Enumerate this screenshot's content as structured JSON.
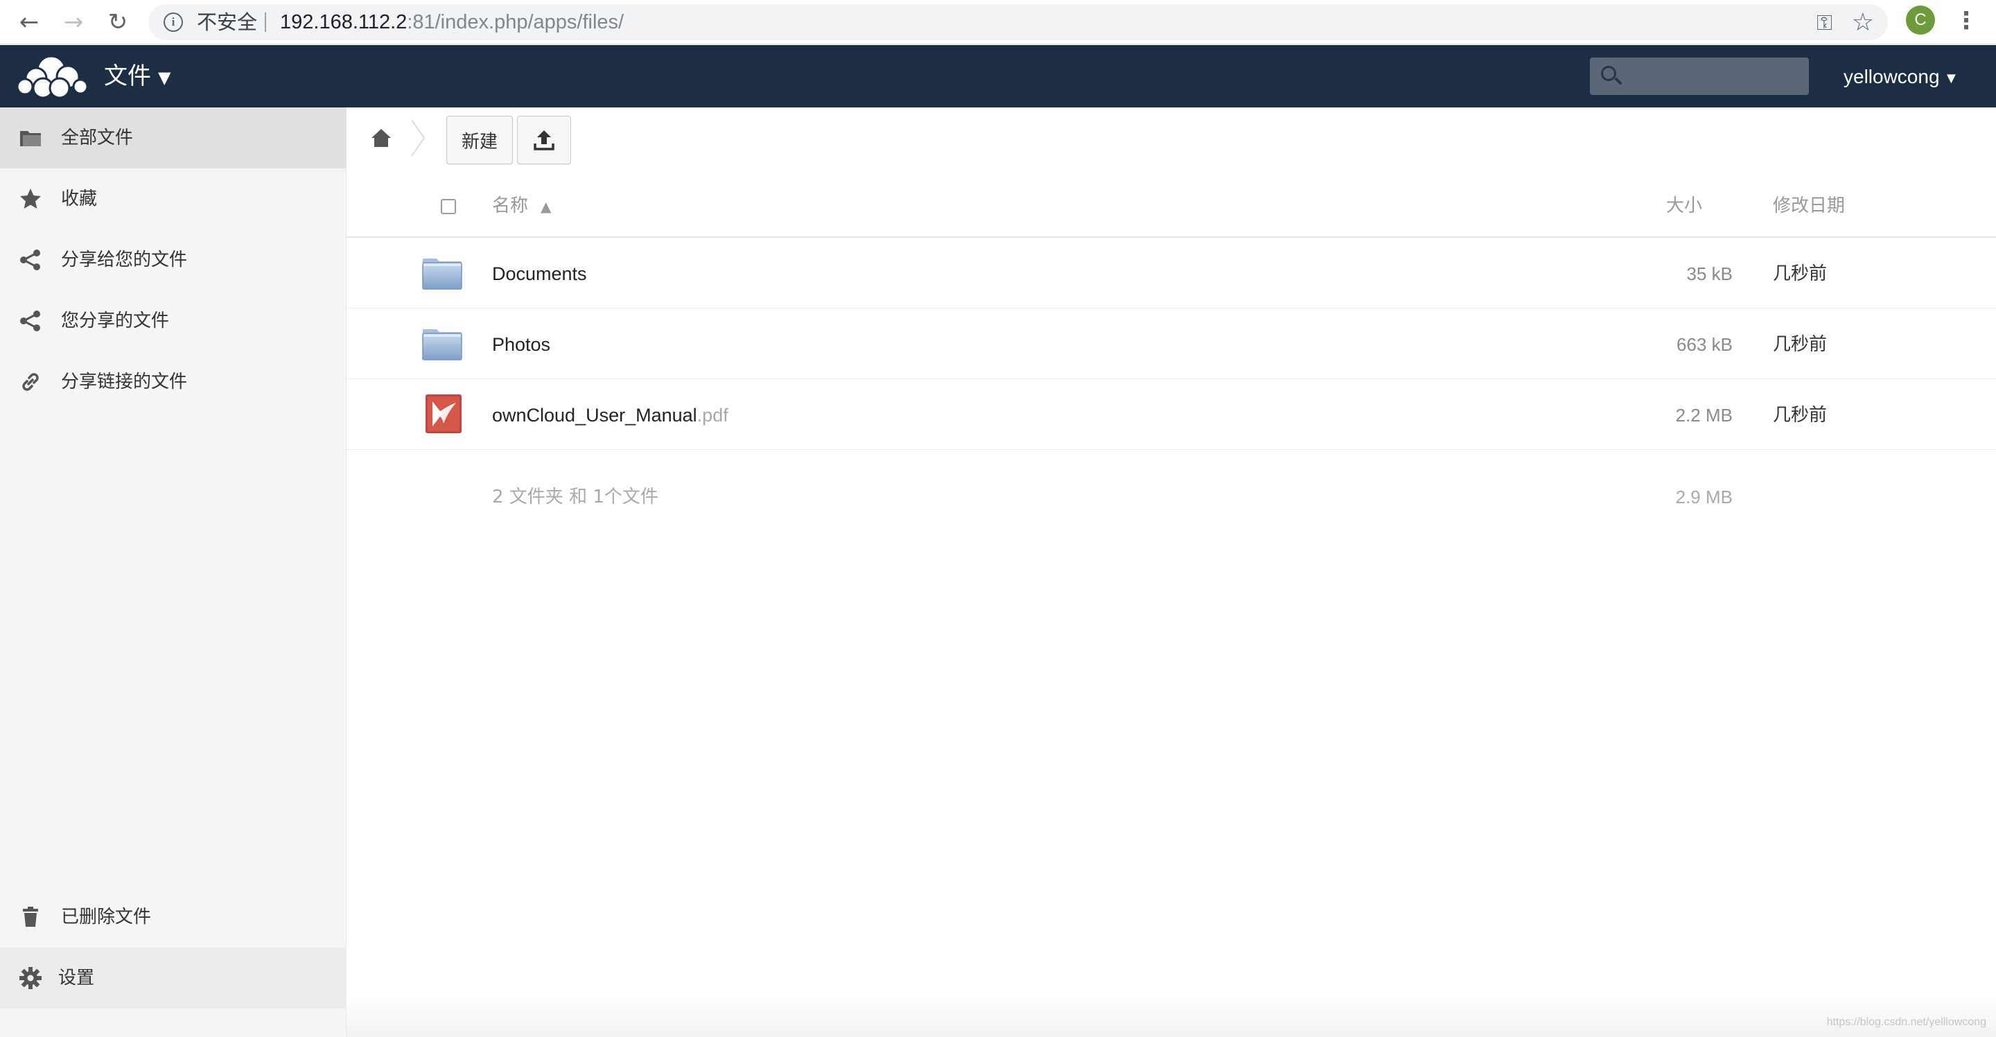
{
  "browser": {
    "security_label": "不安全",
    "url_host": "192.168.112.2",
    "url_rest": ":81/index.php/apps/files/",
    "profile_initial": "C",
    "icons": [
      "back-arrow-icon",
      "forward-arrow-icon",
      "reload-icon",
      "info-icon",
      "key-icon",
      "bookmark-star-icon",
      "kebab-menu-icon"
    ]
  },
  "header": {
    "app_name": "文件",
    "user_name": "yellowcong",
    "search_placeholder": "",
    "background_color": "#1d2d44"
  },
  "sidebar": {
    "items": [
      {
        "label": "全部文件",
        "icon": "folder-icon",
        "active": true
      },
      {
        "label": "收藏",
        "icon": "star-icon"
      },
      {
        "label": "分享给您的文件",
        "icon": "share-icon"
      },
      {
        "label": "您分享的文件",
        "icon": "share-icon"
      },
      {
        "label": "分享链接的文件",
        "icon": "link-icon"
      }
    ],
    "deleted_label": "已删除文件",
    "settings_label": "设置"
  },
  "toolbar": {
    "new_label": "新建",
    "upload_icon": "upload-icon"
  },
  "table": {
    "columns": {
      "name": "名称",
      "sort_indicator": "▲",
      "size": "大小",
      "modified": "修改日期"
    },
    "rows": [
      {
        "name": "Documents",
        "ext": "",
        "type": "folder",
        "size": "35 kB",
        "modified": "几秒前"
      },
      {
        "name": "Photos",
        "ext": "",
        "type": "folder",
        "size": "663 kB",
        "modified": "几秒前"
      },
      {
        "name": "ownCloud_User_Manual",
        "ext": ".pdf",
        "type": "pdf",
        "size": "2.2 MB",
        "modified": "几秒前"
      }
    ],
    "summary_text": "2 文件夹 和 1个文件",
    "summary_size": "2.9 MB"
  },
  "watermark": "https://blog.csdn.net/yelllowcong"
}
